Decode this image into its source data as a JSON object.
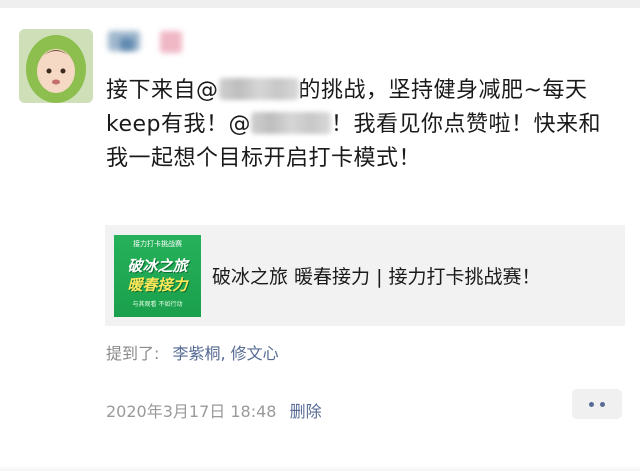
{
  "post": {
    "text_parts": {
      "p1": "接下来自@",
      "p2": "的挑战，坚持健身减肥~每天keep有我！@",
      "p3": "！我看见你点赞啦！快来和我一起想个目标开启打卡模式！"
    }
  },
  "shared_card": {
    "title": "破冰之旅 暖春接力 | 接力打卡挑战赛！",
    "thumbnail": {
      "top": "接力打卡挑战赛",
      "line1": "破冰之旅",
      "line2": "暖春接力",
      "bottom": "与其观看  不如行动"
    }
  },
  "mentions": {
    "label": "提到了:",
    "names": "李紫桐, 修文心"
  },
  "meta": {
    "timestamp": "2020年3月17日 18:48",
    "delete_label": "删除"
  },
  "colors": {
    "link": "#576b95",
    "meta_gray": "#9a9a9a",
    "card_bg": "#f2f2f2"
  },
  "icons": {
    "more": "more-dots-icon"
  }
}
